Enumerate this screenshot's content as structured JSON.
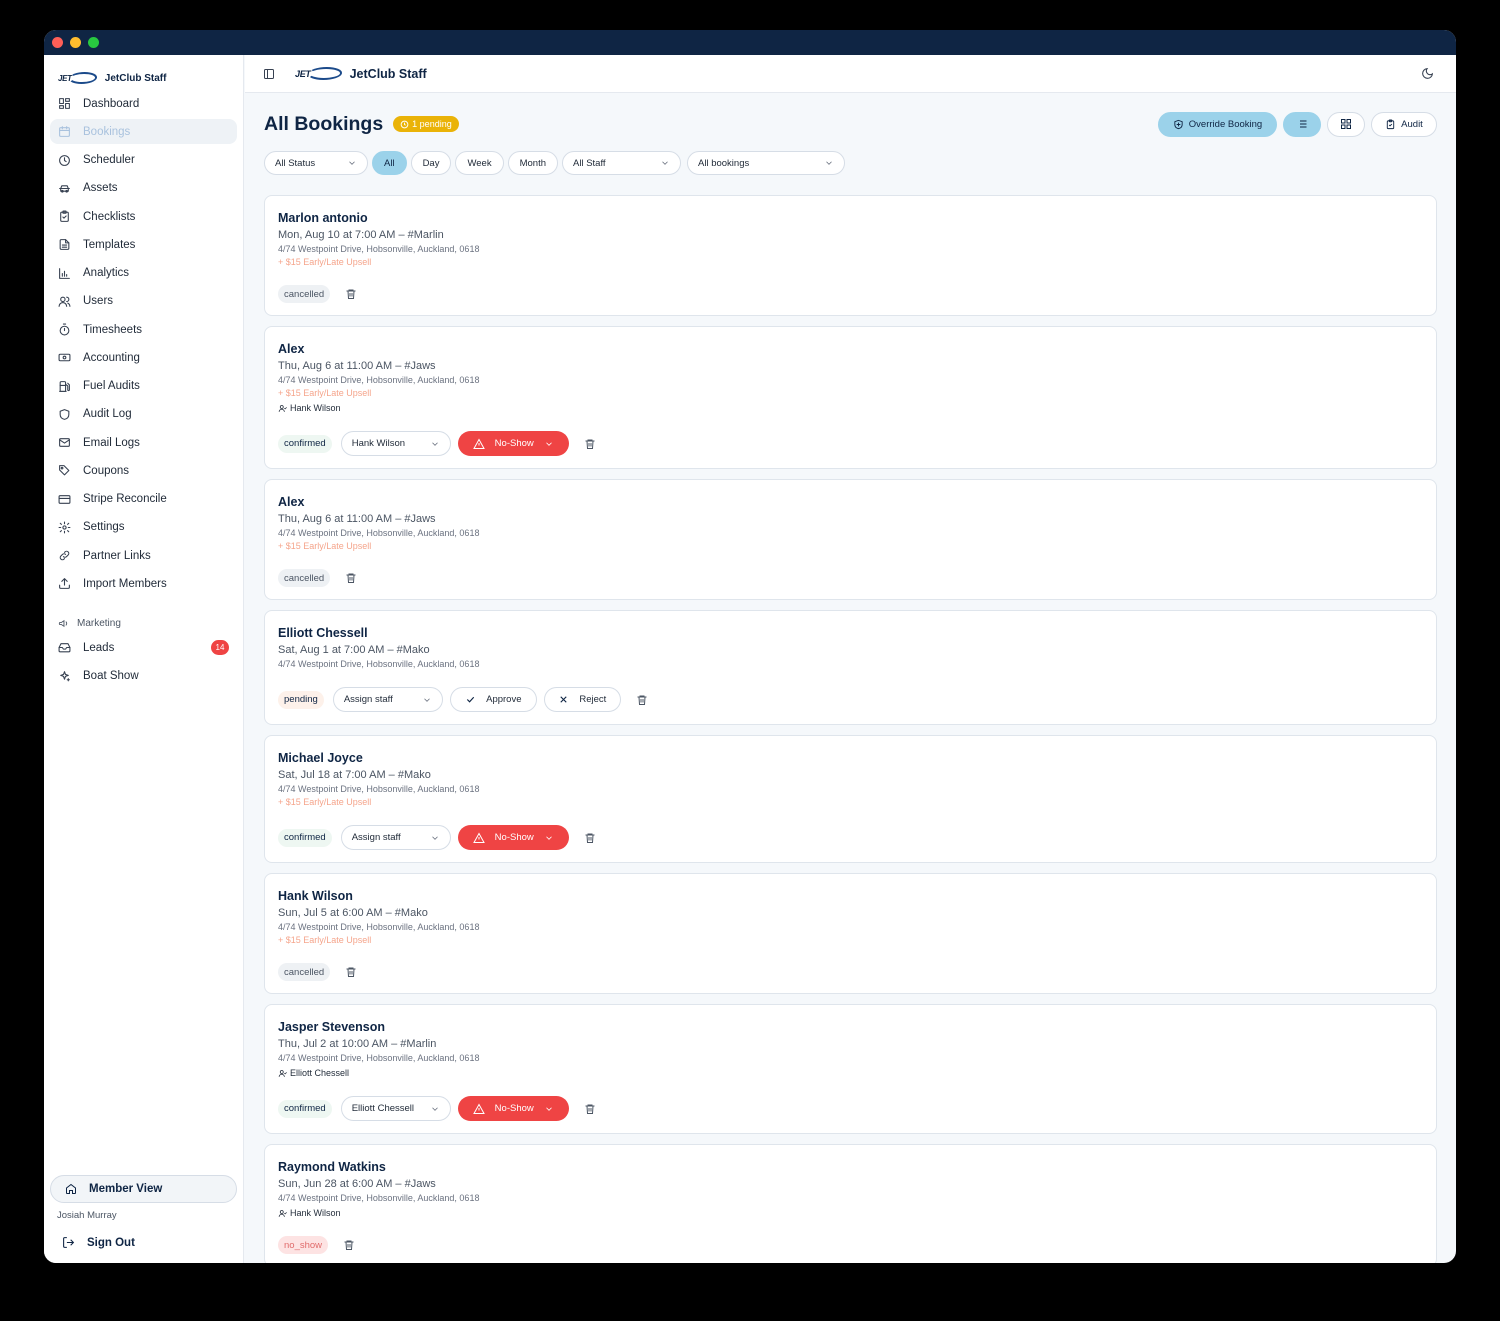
{
  "app": {
    "brand_name": "JetClub Staff",
    "logo_text": "JET"
  },
  "sidebar": {
    "items": [
      {
        "label": "Dashboard",
        "icon": "dashboard-icon",
        "active": false
      },
      {
        "label": "Bookings",
        "icon": "calendar-icon",
        "active": true
      },
      {
        "label": "Scheduler",
        "icon": "clock-icon",
        "active": false
      },
      {
        "label": "Assets",
        "icon": "car-icon",
        "active": false
      },
      {
        "label": "Checklists",
        "icon": "clipboard-check-icon",
        "active": false
      },
      {
        "label": "Templates",
        "icon": "file-text-icon",
        "active": false
      },
      {
        "label": "Analytics",
        "icon": "bar-chart-icon",
        "active": false
      },
      {
        "label": "Users",
        "icon": "users-icon",
        "active": false
      },
      {
        "label": "Timesheets",
        "icon": "timer-icon",
        "active": false
      },
      {
        "label": "Accounting",
        "icon": "banknote-icon",
        "active": false
      },
      {
        "label": "Fuel Audits",
        "icon": "fuel-icon",
        "active": false
      },
      {
        "label": "Audit Log",
        "icon": "shield-icon",
        "active": false
      },
      {
        "label": "Email Logs",
        "icon": "mail-icon",
        "active": false
      },
      {
        "label": "Coupons",
        "icon": "tag-icon",
        "active": false
      },
      {
        "label": "Stripe Reconcile",
        "icon": "credit-card-icon",
        "active": false
      },
      {
        "label": "Settings",
        "icon": "gear-icon",
        "active": false
      },
      {
        "label": "Partner Links",
        "icon": "link-icon",
        "active": false
      },
      {
        "label": "Import Members",
        "icon": "upload-icon",
        "active": false
      }
    ],
    "marketing_label": "Marketing",
    "marketing_items": [
      {
        "label": "Leads",
        "icon": "inbox-icon",
        "badge": "14"
      },
      {
        "label": "Boat Show",
        "icon": "sparkles-icon",
        "badge": ""
      }
    ],
    "member_view_label": "Member View",
    "user_name": "Josiah Murray",
    "sign_out_label": "Sign Out"
  },
  "header": {
    "title": "All Bookings",
    "pending_badge": "1 pending",
    "override_label": "Override Booking",
    "audit_label": "Audit"
  },
  "filters": {
    "status": "All Status",
    "ranges": [
      "All",
      "Day",
      "Week",
      "Month"
    ],
    "active_range": "All",
    "staff": "All Staff",
    "bookings": "All bookings"
  },
  "colors": {
    "accent": "#9bd2ea",
    "danger": "#ef4444",
    "pending": "#eab308",
    "navy": "#0f2544"
  },
  "bookings": [
    {
      "name": "Marlon antonio",
      "when": "Mon, Aug 10 at 7:00 AM – #Marlin",
      "address": "4/74 Westpoint Drive, Hobsonville, Auckland, 0618",
      "upsell": "+ $15 Early/Late Upsell",
      "staff": "",
      "status": "cancelled",
      "type": "cancelled"
    },
    {
      "name": "Alex",
      "when": "Thu, Aug 6 at 11:00 AM – #Jaws",
      "address": "4/74 Westpoint Drive, Hobsonville, Auckland, 0618",
      "upsell": "+ $15 Early/Late Upsell",
      "staff": "Hank Wilson",
      "status": "confirmed",
      "type": "confirmed",
      "assign": "Hank Wilson",
      "no_show_label": "No-Show"
    },
    {
      "name": "Alex",
      "when": "Thu, Aug 6 at 11:00 AM – #Jaws",
      "address": "4/74 Westpoint Drive, Hobsonville, Auckland, 0618",
      "upsell": "+ $15 Early/Late Upsell",
      "staff": "",
      "status": "cancelled",
      "type": "cancelled"
    },
    {
      "name": "Elliott Chessell",
      "when": "Sat, Aug 1 at 7:00 AM – #Mako",
      "address": "4/74 Westpoint Drive, Hobsonville, Auckland, 0618",
      "upsell": "",
      "staff": "",
      "status": "pending",
      "type": "pending",
      "assign": "Assign staff",
      "approve_label": "Approve",
      "reject_label": "Reject"
    },
    {
      "name": "Michael Joyce",
      "when": "Sat, Jul 18 at 7:00 AM – #Mako",
      "address": "4/74 Westpoint Drive, Hobsonville, Auckland, 0618",
      "upsell": "+ $15 Early/Late Upsell",
      "staff": "",
      "status": "confirmed",
      "type": "confirmed",
      "assign": "Assign staff",
      "no_show_label": "No-Show"
    },
    {
      "name": "Hank Wilson",
      "when": "Sun, Jul 5 at 6:00 AM – #Mako",
      "address": "4/74 Westpoint Drive, Hobsonville, Auckland, 0618",
      "upsell": "+ $15 Early/Late Upsell",
      "staff": "",
      "status": "cancelled",
      "type": "cancelled"
    },
    {
      "name": "Jasper Stevenson",
      "when": "Thu, Jul 2 at 10:00 AM – #Marlin",
      "address": "4/74 Westpoint Drive, Hobsonville, Auckland, 0618",
      "upsell": "",
      "staff": "Elliott Chessell",
      "status": "confirmed",
      "type": "confirmed",
      "assign": "Elliott Chessell",
      "no_show_label": "No-Show"
    },
    {
      "name": "Raymond Watkins",
      "when": "Sun, Jun 28 at 6:00 AM – #Jaws",
      "address": "4/74 Westpoint Drive, Hobsonville, Auckland, 0618",
      "upsell": "",
      "staff": "Hank Wilson",
      "status": "no_show",
      "type": "no_show"
    }
  ]
}
